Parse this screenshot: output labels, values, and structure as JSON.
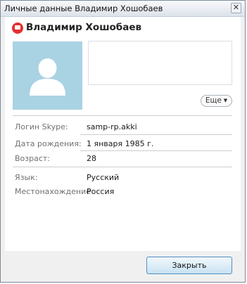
{
  "window": {
    "title": "Личные данные Владимир Хошобаев",
    "close_glyph": "✕"
  },
  "profile": {
    "display_name": "Владимир Хошобаев",
    "status_icon": "skype-status-icon",
    "avatar_icon": "user-silhouette-icon"
  },
  "more_button": {
    "label": "Еще",
    "caret": "▼"
  },
  "fields": [
    {
      "label": "Логин Skype:",
      "value": "samp-rp.akki"
    },
    {
      "label": "Дата рождения:",
      "value": "1 января 1985 г."
    },
    {
      "label": "Возраст:",
      "value": "28"
    },
    {
      "label": "Язык:",
      "value": "Русский"
    },
    {
      "label": "Местонахождение",
      "value": "Россия"
    }
  ],
  "footer": {
    "close_label": "Закрыть"
  },
  "colors": {
    "avatar_bg": "#a9d2e3",
    "accent_red": "#e2312e",
    "button_border": "#4f8fc0"
  }
}
